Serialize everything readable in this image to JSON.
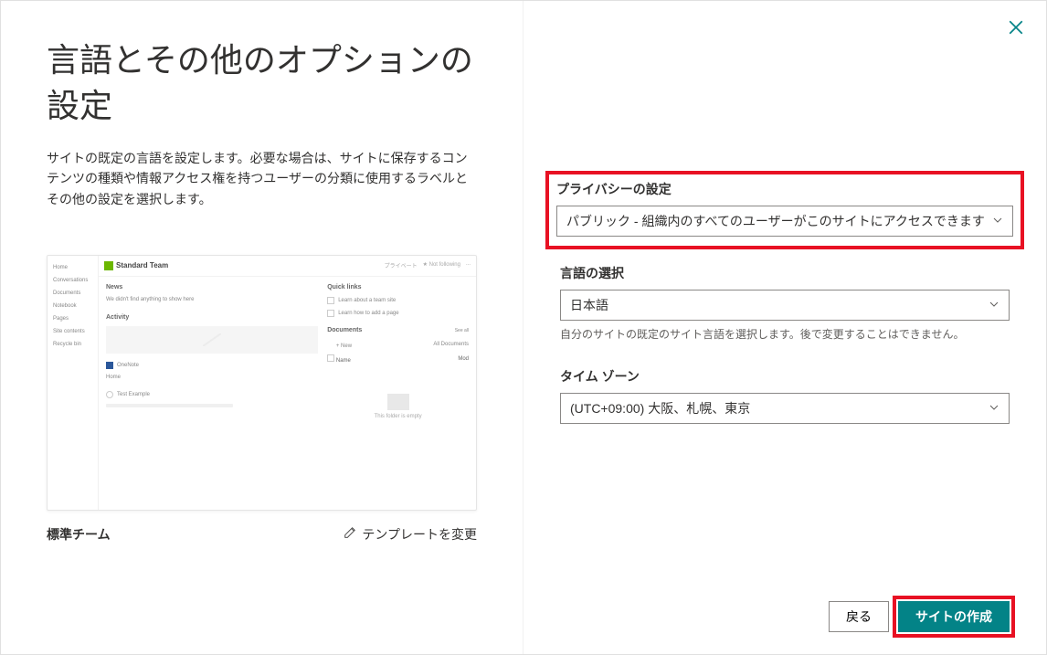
{
  "dialog": {
    "title": "言語とその他のオプションの設定",
    "description": "サイトの既定の言語を設定します。必要な場合は、サイトに保存するコンテンツの種類や情報アクセス権を持つユーザーの分類に使用するラベルとその他の設定を選択します。",
    "close_label": "閉じる"
  },
  "template": {
    "name": "標準チーム",
    "change_label": "テンプレートを変更",
    "preview": {
      "site_title": "Standard Team",
      "header_links": [
        "プライベート",
        "★ Not following",
        "..."
      ],
      "nav": [
        "Home",
        "Conversations",
        "Documents",
        "Notebook",
        "Pages",
        "Site contents",
        "Recycle bin"
      ],
      "news_title": "News",
      "news_placeholder": "We didn't find anything to show here",
      "activity_title": "Activity",
      "activity_item1": "OneNote",
      "activity_item2": "Home",
      "activity_item3": "Test Example",
      "quicklinks_title": "Quick links",
      "ql1": "Learn about a team site",
      "ql2": "Learn how to add a page",
      "documents_title": "Documents",
      "doc_new": "+ New",
      "doc_all": "All Documents",
      "doc_seeall": "See all",
      "doc_name": "Name",
      "doc_mod": "Mod",
      "folder_empty": "This folder is empty"
    }
  },
  "fields": {
    "privacy": {
      "label": "プライバシーの設定",
      "value": "パブリック - 組織内のすべてのユーザーがこのサイトにアクセスできます"
    },
    "language": {
      "label": "言語の選択",
      "value": "日本語",
      "help": "自分のサイトの既定のサイト言語を選択します。後で変更することはできません。"
    },
    "timezone": {
      "label": "タイム ゾーン",
      "value": "(UTC+09:00) 大阪、札幌、東京"
    }
  },
  "buttons": {
    "back": "戻る",
    "create": "サイトの作成"
  }
}
